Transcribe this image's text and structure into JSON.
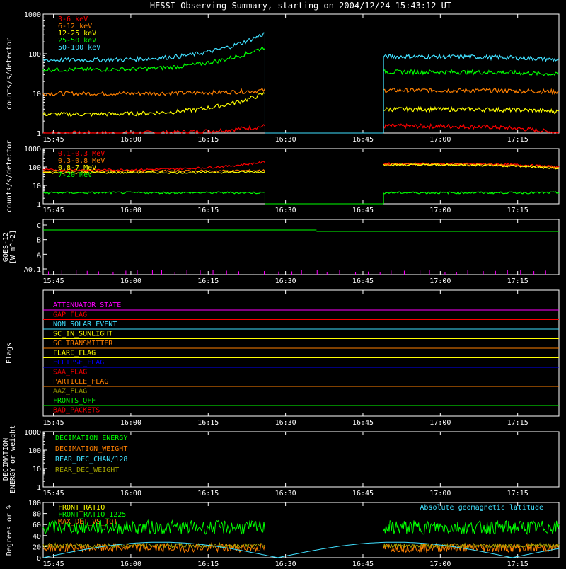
{
  "title": "HESSI Observing Summary, starting on 2004/12/24 15:43:12 UT",
  "x_ticks": [
    "15:45",
    "16:00",
    "16:15",
    "16:30",
    "16:45",
    "17:00",
    "17:15"
  ],
  "colors": {
    "red": "#ff0000",
    "orange": "#ff8000",
    "yellow": "#ffff00",
    "green": "#00ff00",
    "cyan": "#40e0ff",
    "magenta": "#ff00ff",
    "blue": "#0000ff",
    "olive": "#a0a000",
    "white": "#ffffff"
  },
  "chart_data": [
    {
      "type": "line",
      "ylabel": "counts/s/detector",
      "ylog": true,
      "ylim": [
        1,
        1000
      ],
      "ytick_labels": [
        "1",
        "10",
        "100",
        "1000"
      ],
      "xlim": [
        "15:43",
        "17:23"
      ],
      "gap": [
        "16:26",
        "16:49"
      ],
      "legend": [
        "3-6 keV",
        "6-12 keV",
        "12-25 keV",
        "25-50 keV",
        "50-100 keV"
      ],
      "series": [
        {
          "name": "3-6 keV",
          "color": "red",
          "before": [
            1,
            1.5
          ],
          "after": [
            1.5,
            1
          ]
        },
        {
          "name": "6-12 keV",
          "color": "orange",
          "before": [
            10,
            12
          ],
          "after": [
            12,
            11
          ]
        },
        {
          "name": "12-25 keV",
          "color": "yellow",
          "before": [
            3,
            10
          ],
          "after": [
            4,
            3.5
          ]
        },
        {
          "name": "25-50 keV",
          "color": "green",
          "before": [
            40,
            150
          ],
          "after": [
            35,
            30
          ]
        },
        {
          "name": "50-100 keV",
          "color": "cyan",
          "before": [
            70,
            330
          ],
          "after": [
            85,
            70
          ]
        }
      ]
    },
    {
      "type": "line",
      "ylabel": "counts/s/detector",
      "ylog": true,
      "ylim": [
        1,
        1000
      ],
      "ytick_labels": [
        "1",
        "10",
        "100",
        "1000"
      ],
      "legend": [
        "0.1-0.3 MeV",
        "0.3-0.8 MeV",
        "0.8-7 MeV",
        "7-20 MeV"
      ],
      "series": [
        {
          "name": "0.1-0.3 MeV",
          "color": "red",
          "before": [
            70,
            190
          ],
          "after": [
            150,
            100
          ]
        },
        {
          "name": "0.3-0.8 MeV",
          "color": "orange",
          "before": [
            60,
            65
          ],
          "after": [
            140,
            90
          ]
        },
        {
          "name": "0.8-7 MeV",
          "color": "yellow",
          "before": [
            50,
            55
          ],
          "after": [
            130,
            80
          ]
        },
        {
          "name": "7-20 MeV",
          "color": "green",
          "before": [
            4,
            4
          ],
          "after": [
            4,
            4
          ]
        }
      ]
    },
    {
      "type": "line",
      "ylabel": "GOES-12 [W m^-2]",
      "ytick_labels": [
        "A0.1",
        "A",
        "B",
        "C"
      ],
      "series": [
        {
          "name": "GOES",
          "color": "green",
          "level": "B-C"
        }
      ]
    },
    {
      "type": "table",
      "ylabel": "Flags",
      "flags": [
        {
          "label": "ATTENUATOR_STATE",
          "color": "magenta"
        },
        {
          "label": "GAP_FLAG",
          "color": "red"
        },
        {
          "label": "NON_SOLAR_EVENT",
          "color": "cyan"
        },
        {
          "label": "SC_IN_SUNLIGHT",
          "color": "yellow"
        },
        {
          "label": "SC_TRANSMITTER",
          "color": "orange"
        },
        {
          "label": "FLARE_FLAG",
          "color": "yellow"
        },
        {
          "label": "ECLIPSE_FLAG",
          "color": "blue"
        },
        {
          "label": "SAA_FLAG",
          "color": "red"
        },
        {
          "label": "PARTICLE_FLAG",
          "color": "orange"
        },
        {
          "label": "AAZ_FLAG",
          "color": "olive"
        },
        {
          "label": "FRONTS_OFF",
          "color": "green"
        },
        {
          "label": "BAD_PACKETS",
          "color": "red"
        }
      ]
    },
    {
      "type": "line",
      "ylabel": "DECIMATION ENERGY or weight",
      "ylog": true,
      "ylim": [
        1,
        1000
      ],
      "ytick_labels": [
        "1",
        "10",
        "100",
        "1000"
      ],
      "legend": [
        "DECIMATION_ENERGY",
        "DECIMATION_WEIGHT",
        "REAR_DEC_CHAN/128",
        "REAR_DEC_WEIGHT"
      ],
      "legend_colors": [
        "green",
        "orange",
        "cyan",
        "olive"
      ]
    },
    {
      "type": "line",
      "ylabel": "Degrees or %",
      "ylim": [
        0,
        100
      ],
      "ytick_labels": [
        "0",
        "20",
        "40",
        "60",
        "80",
        "100"
      ],
      "legend": [
        "FRONT_RATIO",
        "FRONT_RATIO_1225",
        "MAX_DET_VS_TOT"
      ],
      "legend_colors": [
        "yellow",
        "green",
        "orange"
      ],
      "annotation": "Absolute geomagnetic latitude"
    }
  ]
}
